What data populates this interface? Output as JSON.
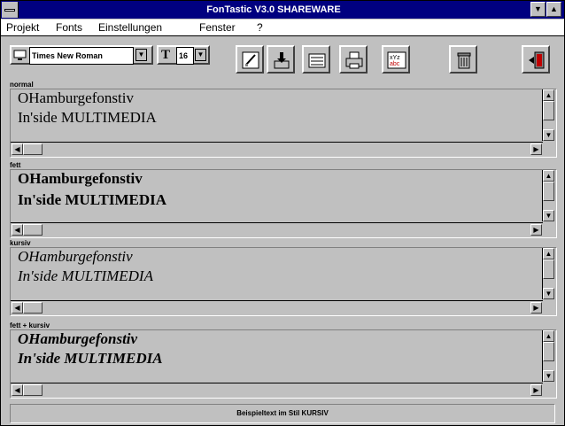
{
  "window": {
    "title": "FonTastic V3.0 SHAREWARE"
  },
  "menu": [
    {
      "label": "Projekt"
    },
    {
      "label": "Fonts"
    },
    {
      "label": "Einstellungen"
    },
    {
      "label": "Fenster"
    },
    {
      "label": "?"
    }
  ],
  "toolbar": {
    "font_value": "Times New Roman",
    "size_value": "16",
    "tools": [
      "edit-icon",
      "install-font-icon",
      "list-icon",
      "print-icon",
      "character-map-icon",
      "trash-icon",
      "exit-door-icon"
    ]
  },
  "panels": [
    {
      "label": "normal",
      "line1": "OHamburgefonstiv",
      "line2": "In'side MULTIMEDIA"
    },
    {
      "label": "fett",
      "line1": "OHamburgefonstiv",
      "line2": "In'side MULTIMEDIA"
    },
    {
      "label": "kursiv",
      "line1": "OHamburgefonstiv",
      "line2": "In'side MULTIMEDIA"
    },
    {
      "label": "fett + kursiv",
      "line1": "OHamburgefonstiv",
      "line2": "In'side MULTIMEDIA"
    }
  ],
  "status": "Beispieltext im Stil KURSIV",
  "colors": {
    "titlebar": "#000080",
    "face": "#c0c0c0",
    "menu_bg": "#ffffff"
  }
}
